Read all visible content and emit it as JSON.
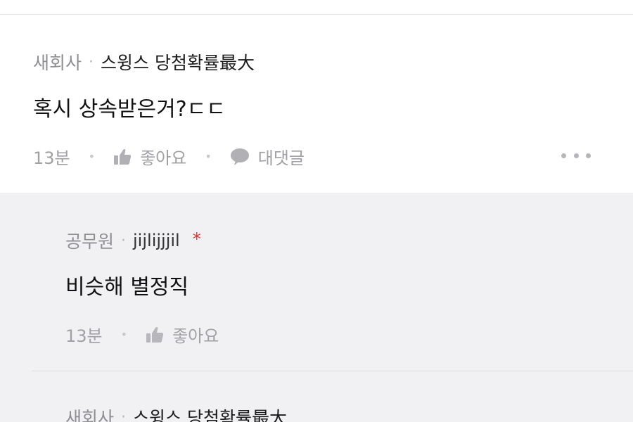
{
  "comment": {
    "company": "새회사",
    "nickname": "스윙스 당첨확률最大",
    "text": "혹시 상속받은거?ㄷㄷ",
    "time": "13분",
    "like_label": "좋아요",
    "reply_label": "대댓글",
    "more_icon": "more-horizontal-icon"
  },
  "replies": [
    {
      "company": "공무원",
      "nickname": "jijlijjjil",
      "author_mark": "*",
      "text": "비슷해 별정직",
      "time": "13분",
      "like_label": "좋아요"
    },
    {
      "company": "새회사",
      "nickname": "스윙스 당첨확률最大"
    }
  ],
  "colors": {
    "reply_background": "#f1f1f4",
    "author_mark": "#e5332a",
    "meta_gray": "#8e8e93"
  },
  "icons": {
    "like": "thumbs-up-icon",
    "reply": "speech-bubble-icon"
  }
}
